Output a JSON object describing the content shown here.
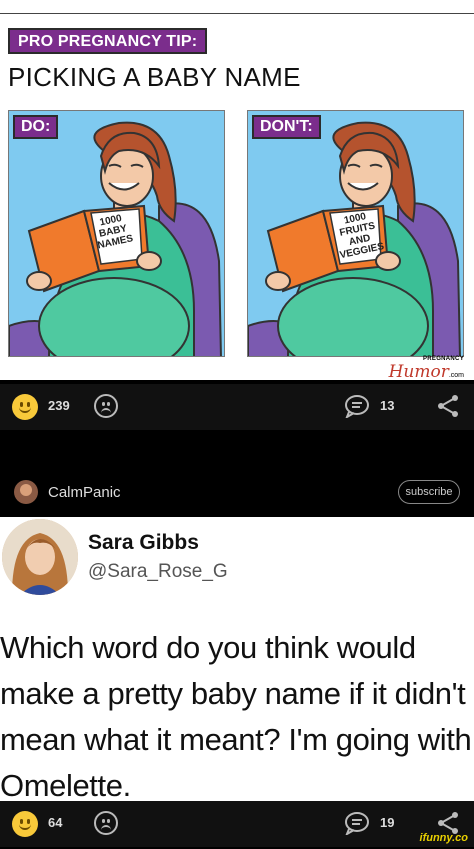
{
  "post1": {
    "comic": {
      "badge": "PRO PREGNANCY TIP:",
      "title": "PICKING A BABY NAME",
      "panels": [
        {
          "label": "DO:",
          "book_lines": [
            "1000",
            "BABY",
            "NAMES"
          ]
        },
        {
          "label": "DON'T:",
          "book_lines": [
            "1000",
            "FRUITS",
            "AND",
            "VEGGIES"
          ]
        }
      ],
      "logo": {
        "small": "PREGNANCY",
        "big": "Humor",
        "suffix": ".com"
      }
    },
    "actions": {
      "smile_count": "239",
      "comment_count": "13"
    }
  },
  "post2": {
    "author": {
      "name": "CalmPanic",
      "subscribe_label": "subscribe"
    },
    "tweet": {
      "name": "Sara Gibbs",
      "handle": "@Sara_Rose_G",
      "lines": [
        "Which word do you think would",
        "make a pretty baby name if it didn't",
        "mean what it meant? I'm going with",
        "Omelette."
      ]
    },
    "actions": {
      "smile_count": "64",
      "comment_count": "19"
    }
  },
  "watermark": "ifunny.co",
  "colors": {
    "badge": "#7b2d8c",
    "panel_bg": "#7fcaf0",
    "smile": "#f8c93a",
    "bar": "#111111"
  }
}
